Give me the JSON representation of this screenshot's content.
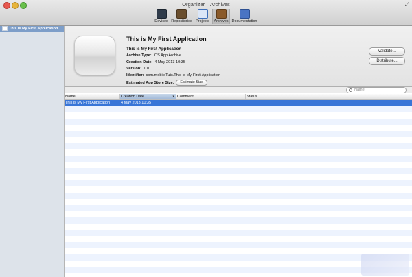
{
  "window": {
    "title": "Organizer – Archives"
  },
  "toolbar": {
    "items": [
      {
        "label": "Devices",
        "icon": "device-icon",
        "color": "#2f3b4a"
      },
      {
        "label": "Repositories",
        "icon": "repositories-icon",
        "color": "#6a4e2d"
      },
      {
        "label": "Projects",
        "icon": "projects-icon",
        "color": "#3f6fb8"
      },
      {
        "label": "Archives",
        "icon": "archives-icon",
        "color": "#8a5a2a"
      },
      {
        "label": "Documentation",
        "icon": "documentation-icon",
        "color": "#4a74c4"
      }
    ],
    "active": "Archives"
  },
  "sidebar": {
    "items": [
      {
        "label": "This is My First Application",
        "selected": true
      }
    ]
  },
  "detail": {
    "title": "This is My First Application",
    "name": "This is My First Application",
    "archive_type_label": "Archive Type:",
    "archive_type": "iOS App Archive",
    "creation_date_label": "Creation Date:",
    "creation_date": "4 May 2013 10:35",
    "version_label": "Version:",
    "version": "1.0",
    "identifier_label": "Identifier:",
    "identifier": "com.mobileTuts.This-is-My-First-Application",
    "est_size_label": "Estimated App Store Size:",
    "estimate_button": "Estimate Size",
    "validate_button": "Validate...",
    "distribute_button": "Distribute..."
  },
  "search": {
    "placeholder": "Name"
  },
  "table": {
    "columns": [
      "Name",
      "Creation Date",
      "Comment",
      "Status"
    ],
    "sorted_column": "Creation Date",
    "rows": [
      {
        "name": "This is My First Application",
        "creation_date": "4 May 2013 10:35",
        "comment": "",
        "status": "",
        "selected": true
      }
    ]
  },
  "colors": {
    "selection": "#3875d7",
    "sidebar_selection": "#7d9ec9",
    "alt_row": "#edf3fe"
  }
}
